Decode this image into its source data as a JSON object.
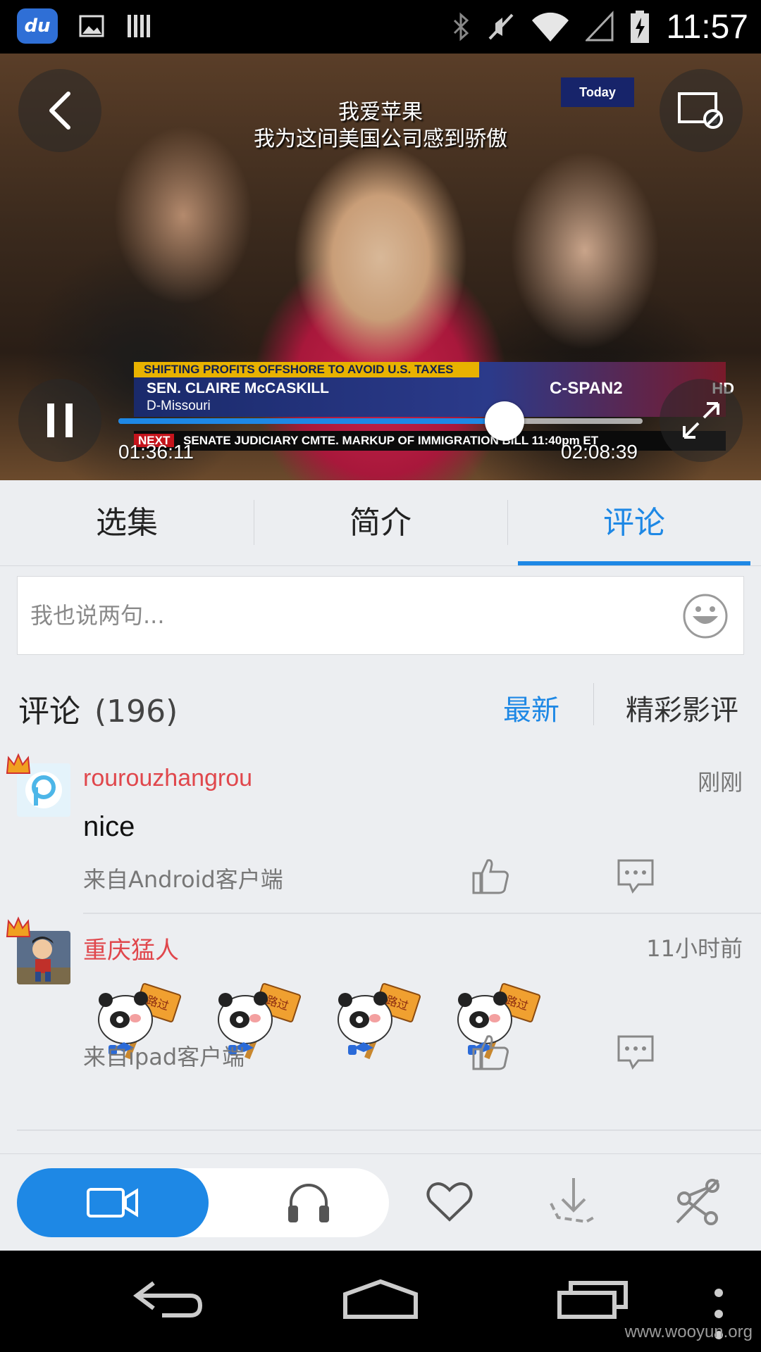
{
  "status_bar": {
    "time": "11:57",
    "app_badge": "du"
  },
  "video": {
    "subtitle_line1": "我爱苹果",
    "subtitle_line2": "我为这间美国公司感到骄傲",
    "overlay_banner": "SHIFTING PROFITS OFFSHORE TO AVOID U.S. TAXES",
    "overlay_name": "SEN. CLAIRE McCASKILL",
    "overlay_state": "D-Missouri",
    "overlay_channel": "C-SPAN2",
    "overlay_hd": "HD",
    "overlay_today": "Today",
    "overlay_next": "NEXT",
    "overlay_ticker": "SENATE JUDICIARY CMTE. MARKUP OF IMMIGRATION BILL  11:40pm ET",
    "current_time": "01:36:11",
    "total_time": "02:08:39",
    "progress": 0.737
  },
  "tabs": [
    {
      "label": "选集",
      "active": false
    },
    {
      "label": "简介",
      "active": false
    },
    {
      "label": "评论",
      "active": true
    }
  ],
  "comment_input": {
    "placeholder": "我也说两句..."
  },
  "comments_header": {
    "title": "评论",
    "count": "(196)",
    "sort_latest": "最新",
    "sort_featured": "精彩影评"
  },
  "comments": [
    {
      "user": "rourouzhangrou",
      "time": "刚刚",
      "text": "nice",
      "source": "来自Android客户端"
    },
    {
      "user": "重庆猛人",
      "time": "11小时前",
      "text": "",
      "stickers": [
        "路过",
        "路过",
        "路过",
        "路过"
      ],
      "source": "来自ipad客户端"
    }
  ],
  "action_bar": {
    "icons": [
      "video-icon",
      "headphones-icon",
      "heart-icon",
      "download-icon",
      "share-icon"
    ]
  },
  "watermark": "www.wooyun.org",
  "colors": {
    "accent": "#1e88e5",
    "username": "#e0474c",
    "background": "#eceef1"
  }
}
